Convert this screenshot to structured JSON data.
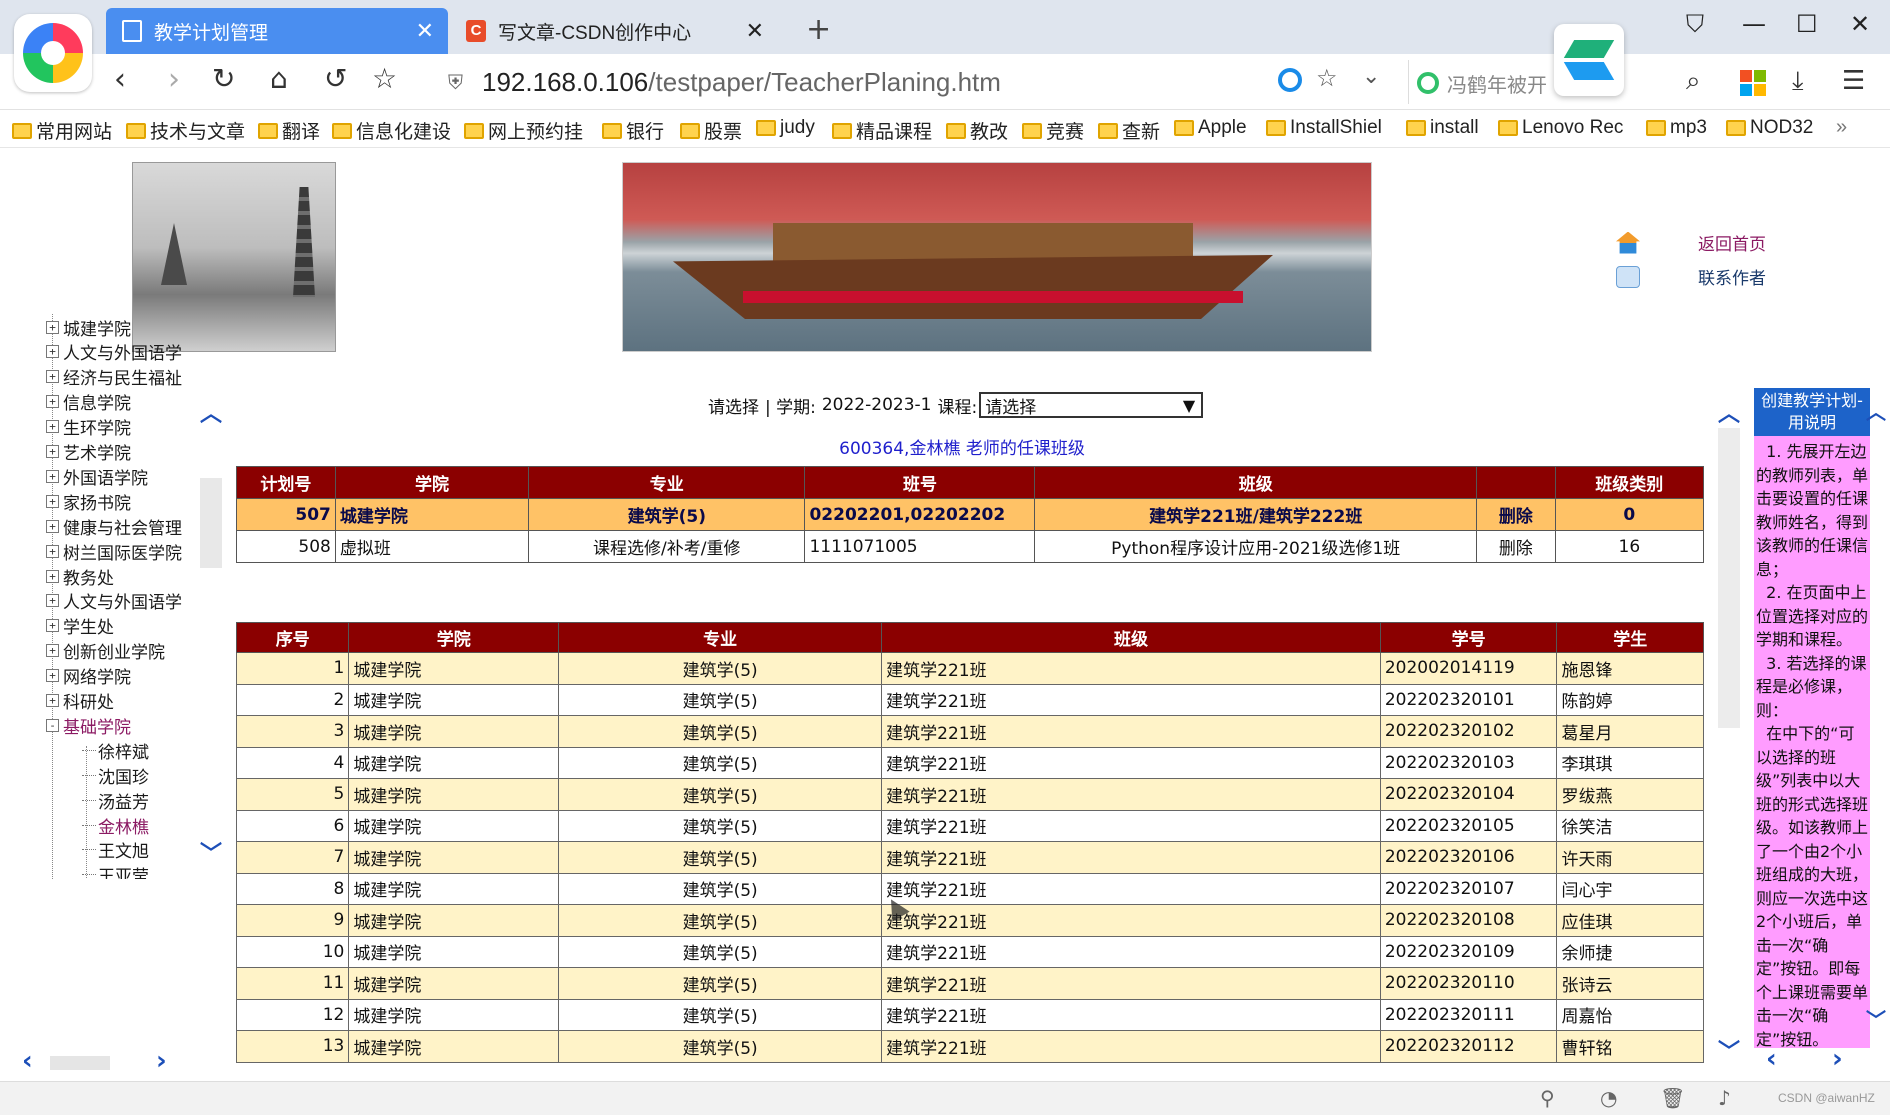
{
  "browser": {
    "tabs": [
      {
        "title": "教学计划管理",
        "active": true
      },
      {
        "title": "写文章-CSDN创作中心",
        "active": false
      }
    ],
    "url_host": "192.168.0.106",
    "url_path": "/testpaper/TeacherPlaning.htm",
    "search_text": "冯鹤年被开",
    "bookmarks": [
      "常用网站",
      "技术与文章",
      "翻译",
      "信息化建设",
      "网上预约挂",
      "银行",
      "股票",
      "judy",
      "精品课程",
      "教改",
      "竞赛",
      "查新",
      "Apple",
      "InstallShiel",
      "install",
      "Lenovo Rec",
      "mp3",
      "NOD32"
    ]
  },
  "header": {
    "home_link": "返回首页",
    "contact_link": "联系作者"
  },
  "tree": {
    "items": [
      {
        "label": "城建学院",
        "toggle": "+"
      },
      {
        "label": "人文与外国语学",
        "toggle": "+"
      },
      {
        "label": "经济与民生福祉",
        "toggle": "+"
      },
      {
        "label": "信息学院",
        "toggle": "+"
      },
      {
        "label": "生环学院",
        "toggle": "+"
      },
      {
        "label": "艺术学院",
        "toggle": "+"
      },
      {
        "label": "外国语学院",
        "toggle": "+"
      },
      {
        "label": "家扬书院",
        "toggle": "+"
      },
      {
        "label": "健康与社会管理",
        "toggle": "+"
      },
      {
        "label": "树兰国际医学院",
        "toggle": "+"
      },
      {
        "label": "教务处",
        "toggle": "+"
      },
      {
        "label": "人文与外国语学",
        "toggle": "+"
      },
      {
        "label": "学生处",
        "toggle": "+"
      },
      {
        "label": "创新创业学院",
        "toggle": "+"
      },
      {
        "label": "网络学院",
        "toggle": "+"
      },
      {
        "label": "科研处",
        "toggle": "+"
      },
      {
        "label": "基础学院",
        "toggle": "-",
        "selected": true
      }
    ],
    "children": [
      {
        "label": "徐梓斌"
      },
      {
        "label": "沈国珍"
      },
      {
        "label": "汤益芳"
      },
      {
        "label": "金林樵",
        "selected": true
      },
      {
        "label": "王文旭"
      },
      {
        "label": "王亚莹"
      }
    ]
  },
  "selector": {
    "prefix": "请选择",
    "term_label": "| 学期:",
    "term_value": "2022-2023-1",
    "course_label": "课程:",
    "course_value": "请选择"
  },
  "teacher_line": "600364,金林樵 老师的任课班级",
  "plan_table": {
    "headers": [
      "计划号",
      "学院",
      "专业",
      "班号",
      "班级",
      "",
      "班级类别"
    ],
    "rows": [
      {
        "plan_no": "507",
        "college": "城建学院",
        "major": "建筑学(5)",
        "class_no": "02202201,02202202",
        "class_name": "建筑学221班/建筑学222班",
        "action": "删除",
        "category": "0",
        "highlight": true
      },
      {
        "plan_no": "508",
        "college": "虚拟班",
        "major": "课程选修/补考/重修",
        "class_no": "1111071005",
        "class_name": "Python程序设计应用-2021级选修1班",
        "action": "删除",
        "category": "16",
        "highlight": false
      }
    ]
  },
  "student_table": {
    "headers": [
      "序号",
      "学院",
      "专业",
      "班级",
      "学号",
      "学生"
    ],
    "rows": [
      {
        "seq": "1",
        "college": "城建学院",
        "major": "建筑学(5)",
        "class": "建筑学221班",
        "id": "202002014119",
        "name": "施恩锋"
      },
      {
        "seq": "2",
        "college": "城建学院",
        "major": "建筑学(5)",
        "class": "建筑学221班",
        "id": "202202320101",
        "name": "陈韵婷"
      },
      {
        "seq": "3",
        "college": "城建学院",
        "major": "建筑学(5)",
        "class": "建筑学221班",
        "id": "202202320102",
        "name": "葛星月"
      },
      {
        "seq": "4",
        "college": "城建学院",
        "major": "建筑学(5)",
        "class": "建筑学221班",
        "id": "202202320103",
        "name": "李琪琪"
      },
      {
        "seq": "5",
        "college": "城建学院",
        "major": "建筑学(5)",
        "class": "建筑学221班",
        "id": "202202320104",
        "name": "罗绂燕"
      },
      {
        "seq": "6",
        "college": "城建学院",
        "major": "建筑学(5)",
        "class": "建筑学221班",
        "id": "202202320105",
        "name": "徐笑洁"
      },
      {
        "seq": "7",
        "college": "城建学院",
        "major": "建筑学(5)",
        "class": "建筑学221班",
        "id": "202202320106",
        "name": "许天雨"
      },
      {
        "seq": "8",
        "college": "城建学院",
        "major": "建筑学(5)",
        "class": "建筑学221班",
        "id": "202202320107",
        "name": "闫心宇"
      },
      {
        "seq": "9",
        "college": "城建学院",
        "major": "建筑学(5)",
        "class": "建筑学221班",
        "id": "202202320108",
        "name": "应佳琪"
      },
      {
        "seq": "10",
        "college": "城建学院",
        "major": "建筑学(5)",
        "class": "建筑学221班",
        "id": "202202320109",
        "name": "余师捷"
      },
      {
        "seq": "11",
        "college": "城建学院",
        "major": "建筑学(5)",
        "class": "建筑学221班",
        "id": "202202320110",
        "name": "张诗云"
      },
      {
        "seq": "12",
        "college": "城建学院",
        "major": "建筑学(5)",
        "class": "建筑学221班",
        "id": "202202320111",
        "name": "周嘉怡"
      },
      {
        "seq": "13",
        "college": "城建学院",
        "major": "建筑学(5)",
        "class": "建筑学221班",
        "id": "202202320112",
        "name": "曹轩铭"
      }
    ]
  },
  "help": {
    "title": "创建教学计划-用说明",
    "body": "  1. 先展开左边的教师列表，单击要设置的任课教师姓名，得到该教师的任课信息；\n  2. 在页面中上位置选择对应的学期和课程。\n  3. 若选择的课程是必修课，则：\n  在中下的“可以选择的班级”列表中以大班的形式选择班级。如该教师上了一个由2个小班组成的大班，则应一次选中这2个小班后，单击一次“确定”按钮。即每个上课班需要单击一次“确定”按钮。"
  },
  "status": {
    "watermark": "CSDN @aiwanHZ"
  }
}
